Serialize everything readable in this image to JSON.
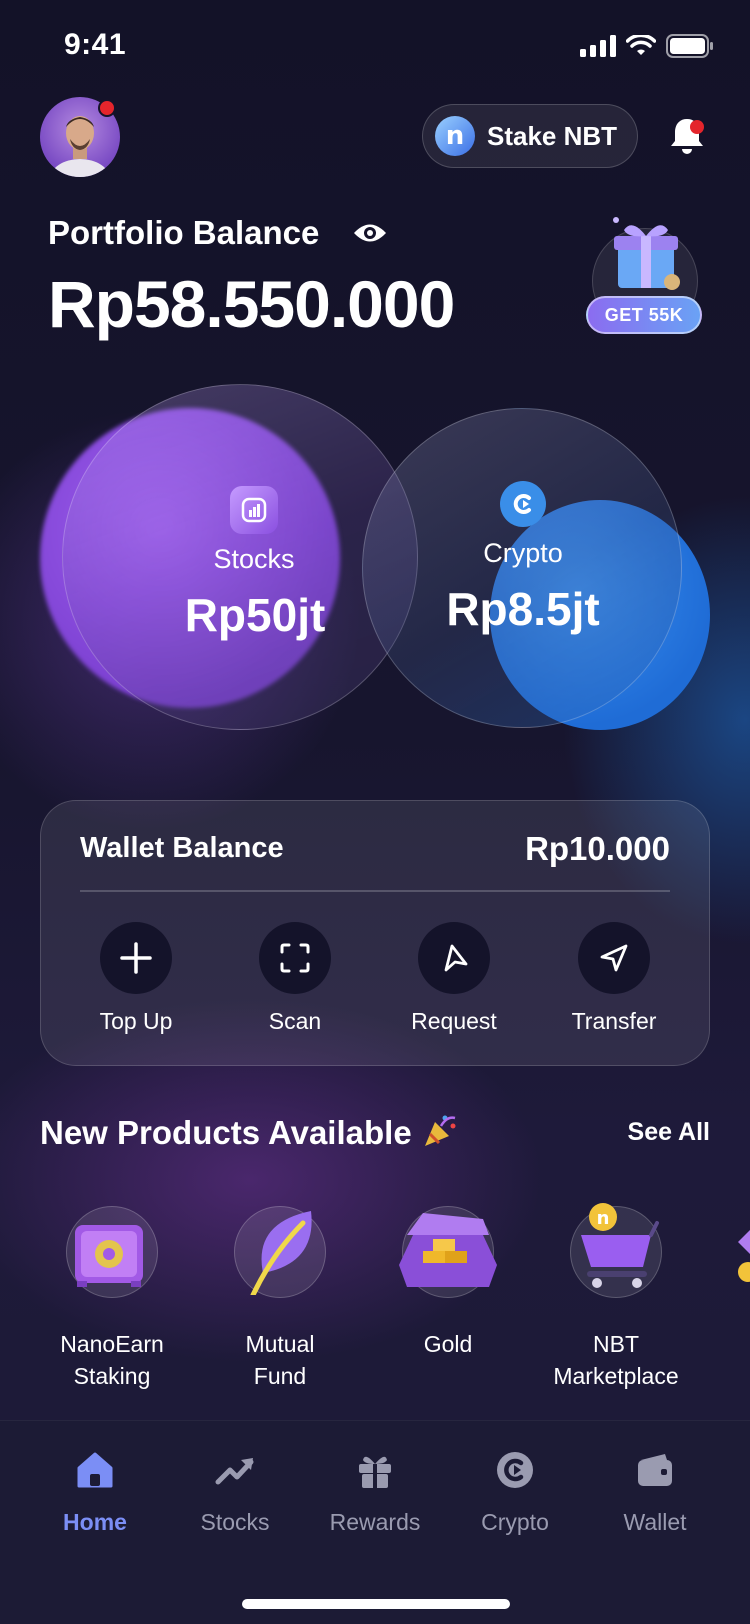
{
  "status_bar": {
    "time": "9:41"
  },
  "header": {
    "stake_label": "Stake NBT"
  },
  "portfolio": {
    "label": "Portfolio Balance",
    "value": "Rp58.550.000",
    "promo_label": "GET 55K"
  },
  "assets": {
    "stocks": {
      "label": "Stocks",
      "value": "Rp50jt"
    },
    "crypto": {
      "label": "Crypto",
      "value": "Rp8.5jt"
    }
  },
  "wallet": {
    "label": "Wallet Balance",
    "value": "Rp10.000",
    "actions": [
      {
        "label": "Top Up",
        "icon": "plus-icon"
      },
      {
        "label": "Scan",
        "icon": "scan-icon"
      },
      {
        "label": "Request",
        "icon": "request-icon"
      },
      {
        "label": "Transfer",
        "icon": "send-icon"
      }
    ]
  },
  "products": {
    "title": "New Products Available",
    "see_all": "See All",
    "items": [
      {
        "label_line1": "NanoEarn",
        "label_line2": "Staking",
        "icon": "safe-icon"
      },
      {
        "label_line1": "Mutual",
        "label_line2": "Fund",
        "icon": "leaf-icon"
      },
      {
        "label_line1": "Gold",
        "label_line2": "",
        "icon": "gold-bars-icon"
      },
      {
        "label_line1": "NBT",
        "label_line2": "Marketplace",
        "icon": "shopping-cart-icon"
      }
    ]
  },
  "nav": {
    "items": [
      {
        "label": "Home",
        "icon": "home-icon",
        "active": true
      },
      {
        "label": "Stocks",
        "icon": "trending-up-icon",
        "active": false
      },
      {
        "label": "Rewards",
        "icon": "gift-icon",
        "active": false
      },
      {
        "label": "Crypto",
        "icon": "crypto-icon",
        "active": false
      },
      {
        "label": "Wallet",
        "icon": "wallet-icon",
        "active": false
      }
    ]
  },
  "colors": {
    "background": "#15132a",
    "accent": "#7b8ef5",
    "notification": "#e4252c",
    "stocks": "#8a4fe0",
    "crypto": "#3a8ee8"
  }
}
